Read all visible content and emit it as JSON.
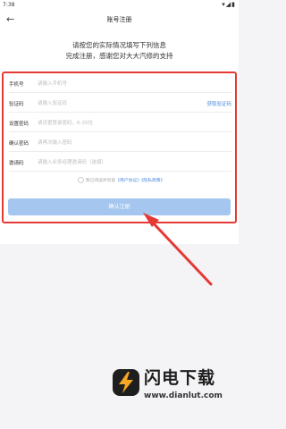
{
  "status": {
    "time": "7:38",
    "icons": "▾◢▮"
  },
  "header": {
    "back": "←",
    "title": "账号注册"
  },
  "intro": {
    "line1": "请按您的实际情况填写下列信息",
    "line2": "完成注册，感谢您对大大汽修的支持"
  },
  "form": {
    "rows": [
      {
        "label": "手机号",
        "placeholder": "请输入手机号"
      },
      {
        "label": "验证码",
        "placeholder": "请输入验证码",
        "action": "获取验证码"
      },
      {
        "label": "设置密码",
        "placeholder": "请设置登录密码，6-20位"
      },
      {
        "label": "确认密码",
        "placeholder": "请再次输入密码"
      },
      {
        "label": "邀请码",
        "placeholder": "请输入业务经理邀请码（选填）"
      }
    ],
    "agree_text": "我已阅读并同意",
    "user_agreement": "《用户协议》",
    "privacy_policy": "《隐私政策》",
    "confirm": "确认注册"
  },
  "watermark": {
    "title": "闪电下载",
    "url": "www.dianlut.com"
  },
  "colors": {
    "highlight": "#e53935",
    "link": "#4a8bdc",
    "button": "#a5c6ee"
  }
}
